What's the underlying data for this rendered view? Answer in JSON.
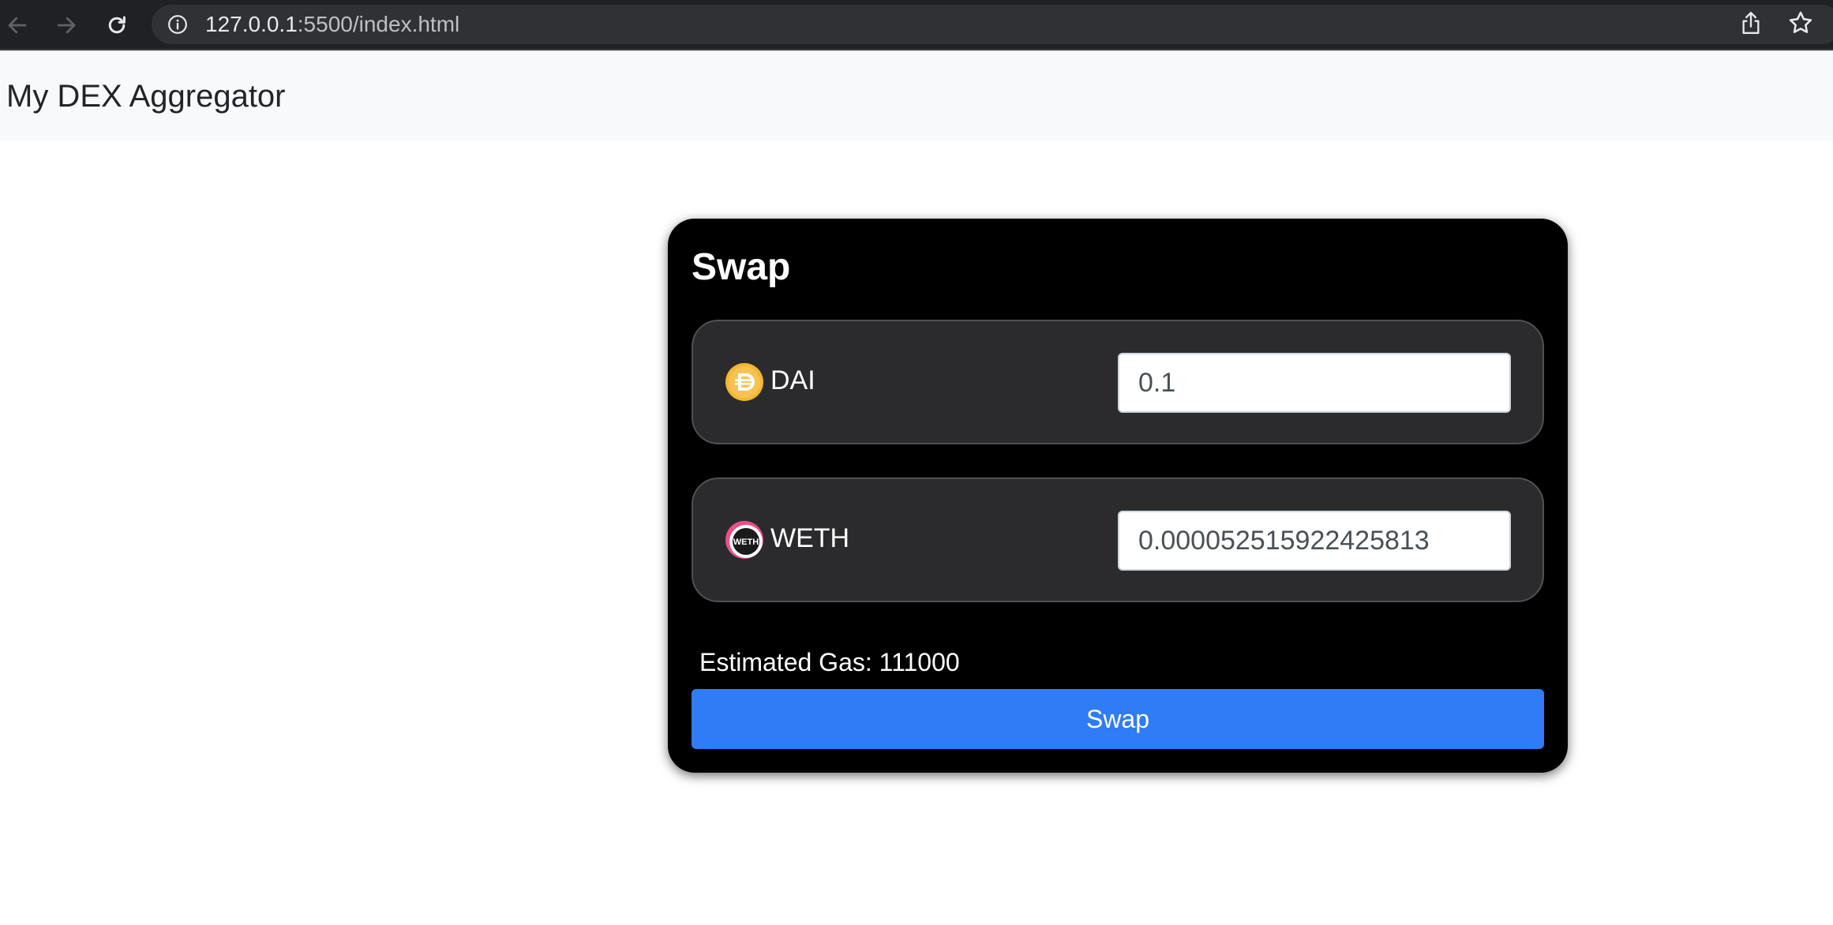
{
  "browser": {
    "url_host": "127.0.0.1",
    "url_rest": ":5500/index.html"
  },
  "header": {
    "brand": "My DEX Aggregator"
  },
  "swap": {
    "title": "Swap",
    "from_token": {
      "symbol": "DAI",
      "amount": "0.1",
      "logo_color": "#f4b731"
    },
    "to_token": {
      "symbol": "WETH",
      "amount": "0.000052515922425813",
      "logo_color": "#ec4e8a"
    },
    "gas_text": "Estimated Gas: 111000",
    "button_label": "Swap"
  },
  "colors": {
    "accent": "#307cf6",
    "card": "#000000",
    "token_box": "#2b2b2d"
  }
}
